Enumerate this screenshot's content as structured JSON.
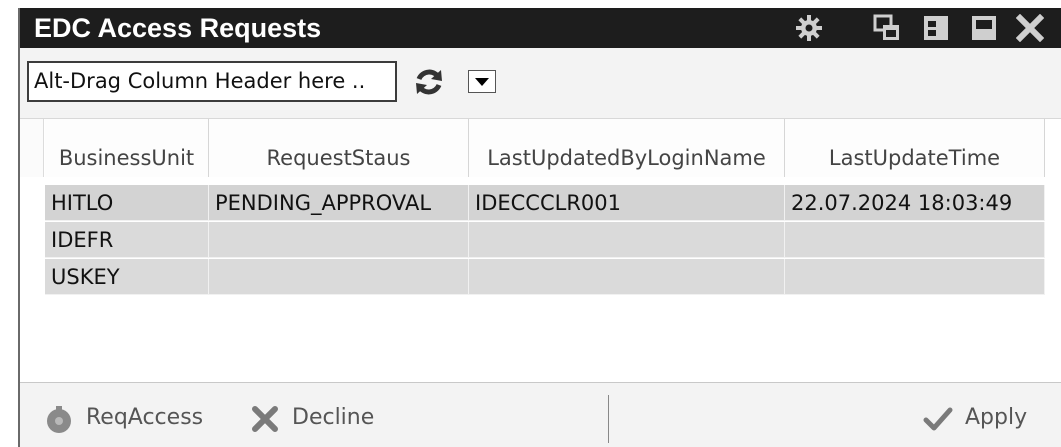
{
  "window": {
    "title": "EDC Access Requests"
  },
  "toolbar": {
    "group_placeholder": "Alt-Drag Column Header here .."
  },
  "grid": {
    "columns": [
      "BusinessUnit",
      "RequestStaus",
      "LastUpdatedByLoginName",
      "LastUpdateTime"
    ],
    "rows": [
      [
        "HITLO",
        "PENDING_APPROVAL",
        "IDECCCLR001",
        "22.07.2024 18:03:49"
      ],
      [
        "IDEFR",
        "",
        "",
        ""
      ],
      [
        "USKEY",
        "",
        "",
        ""
      ]
    ]
  },
  "footer": {
    "req_access_label": "ReqAccess",
    "decline_label": "Decline",
    "apply_label": "Apply"
  },
  "icons": {
    "settings": "gear-icon",
    "restore": "restore-icon",
    "dock": "dock-icon",
    "maximize": "maximize-icon",
    "close": "close-icon",
    "refresh": "refresh-icon",
    "dropdown": "chevron-down-icon",
    "req_access": "key-icon",
    "decline": "x-icon",
    "apply": "check-icon"
  },
  "colors": {
    "titlebar": "#1d1d1d",
    "row_fill": "#dadada",
    "disabled_text": "#555555"
  }
}
